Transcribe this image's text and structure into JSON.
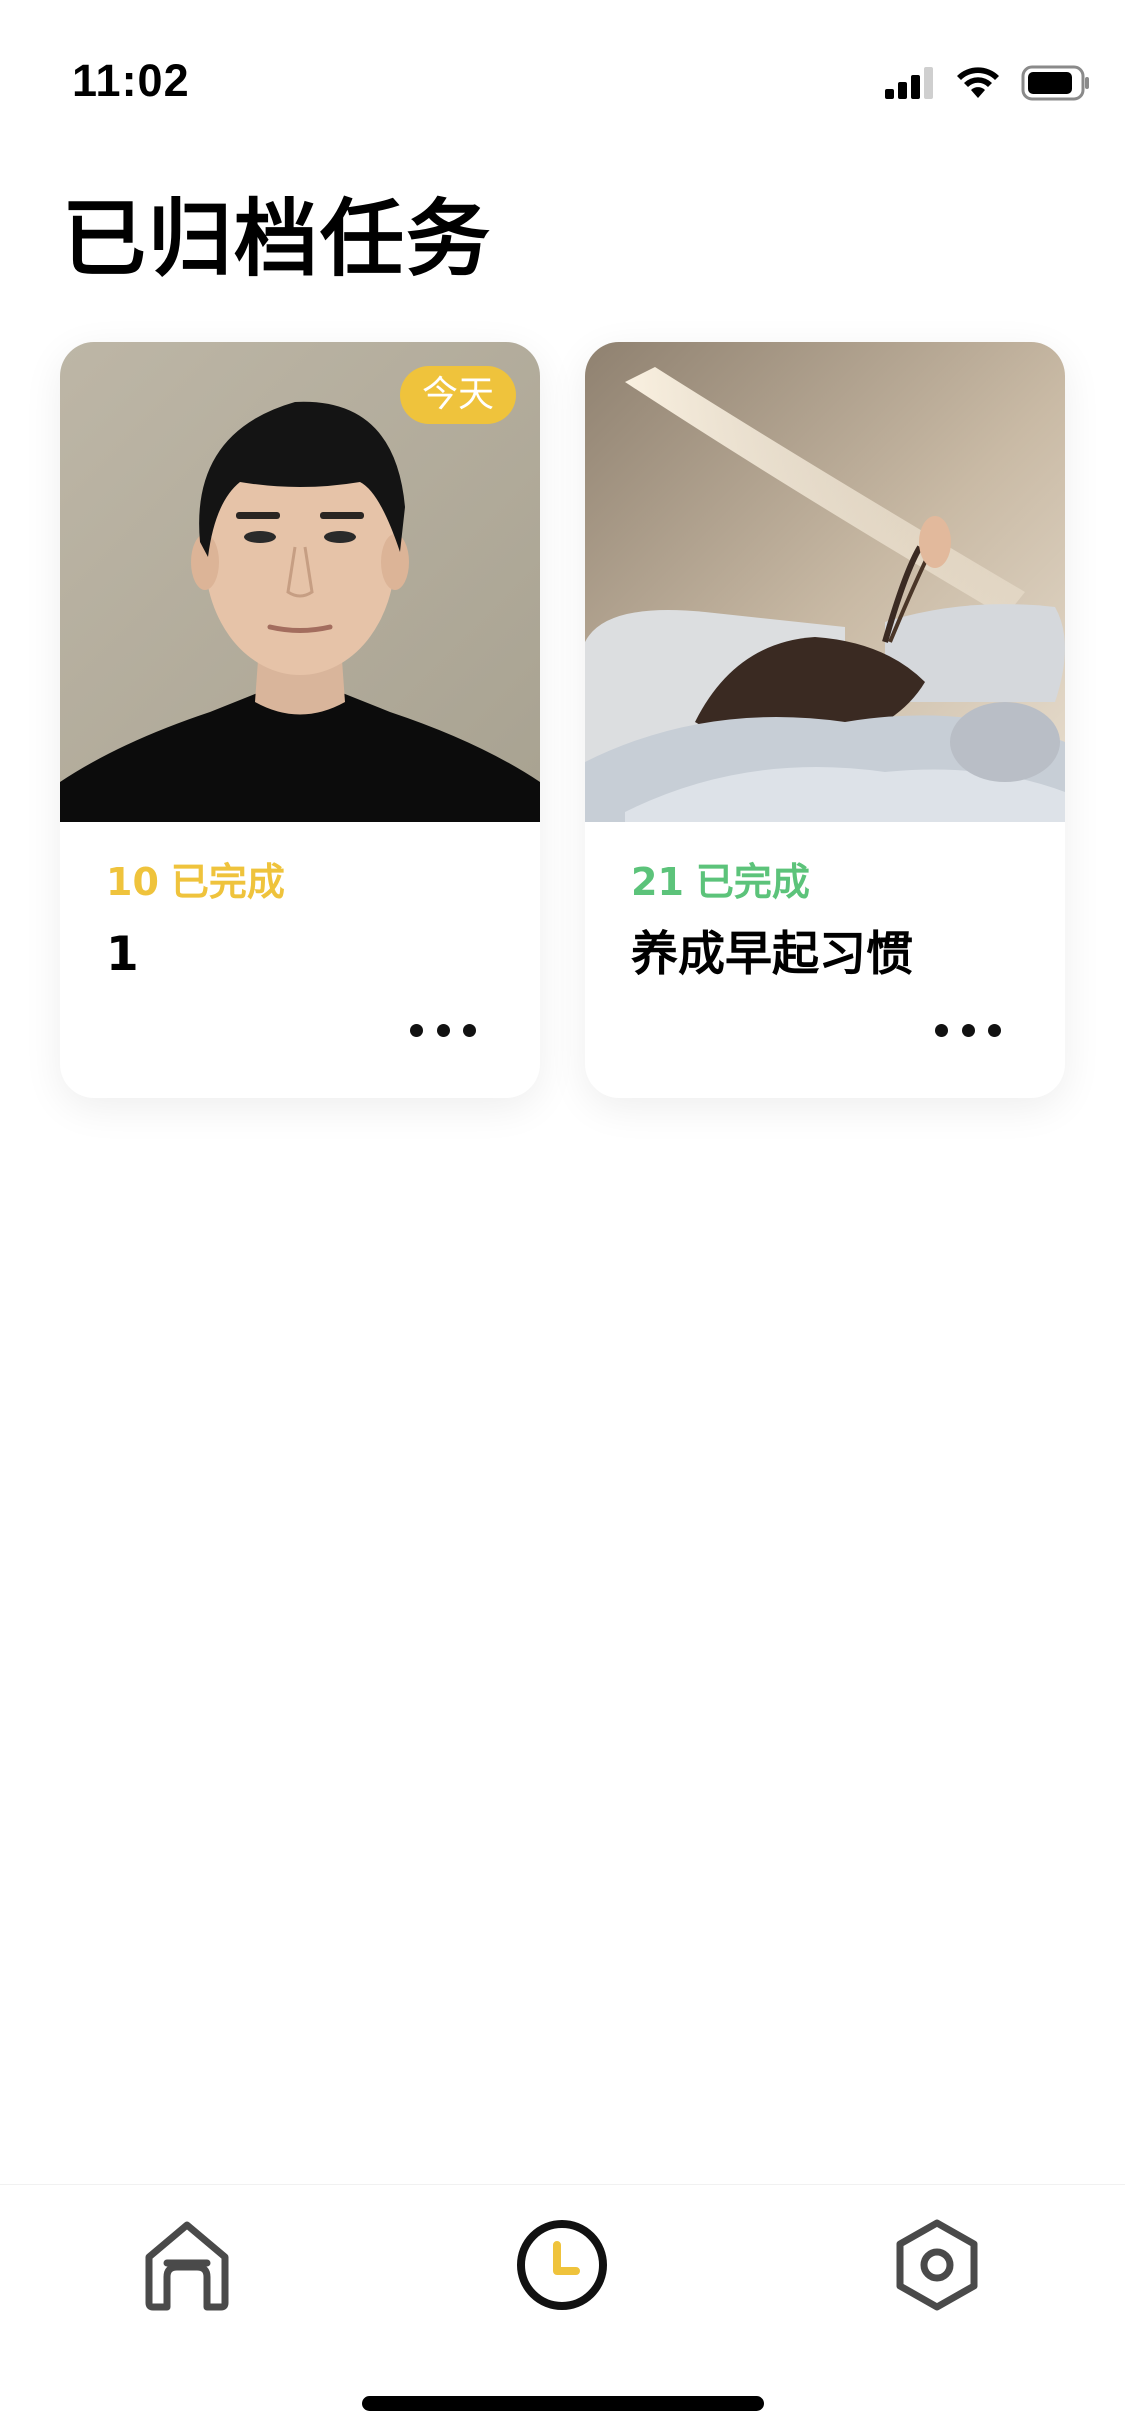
{
  "status_bar": {
    "time": "11:02"
  },
  "page": {
    "title": "已归档任务"
  },
  "cards": [
    {
      "badge": "今天",
      "count": "10",
      "count_label": "已完成",
      "count_color": "#efc33c",
      "title": "1",
      "photo": "portrait-photo"
    },
    {
      "count": "21",
      "count_label": "已完成",
      "count_color": "#5cc37a",
      "title": "养成早起习惯",
      "photo": "bedroom-photo"
    }
  ],
  "tab_bar": {
    "items": [
      {
        "icon": "home-icon",
        "active": false
      },
      {
        "icon": "clock-icon",
        "active": true
      },
      {
        "icon": "hexagon-settings-icon",
        "active": false
      }
    ],
    "accent": "#efc33c"
  }
}
